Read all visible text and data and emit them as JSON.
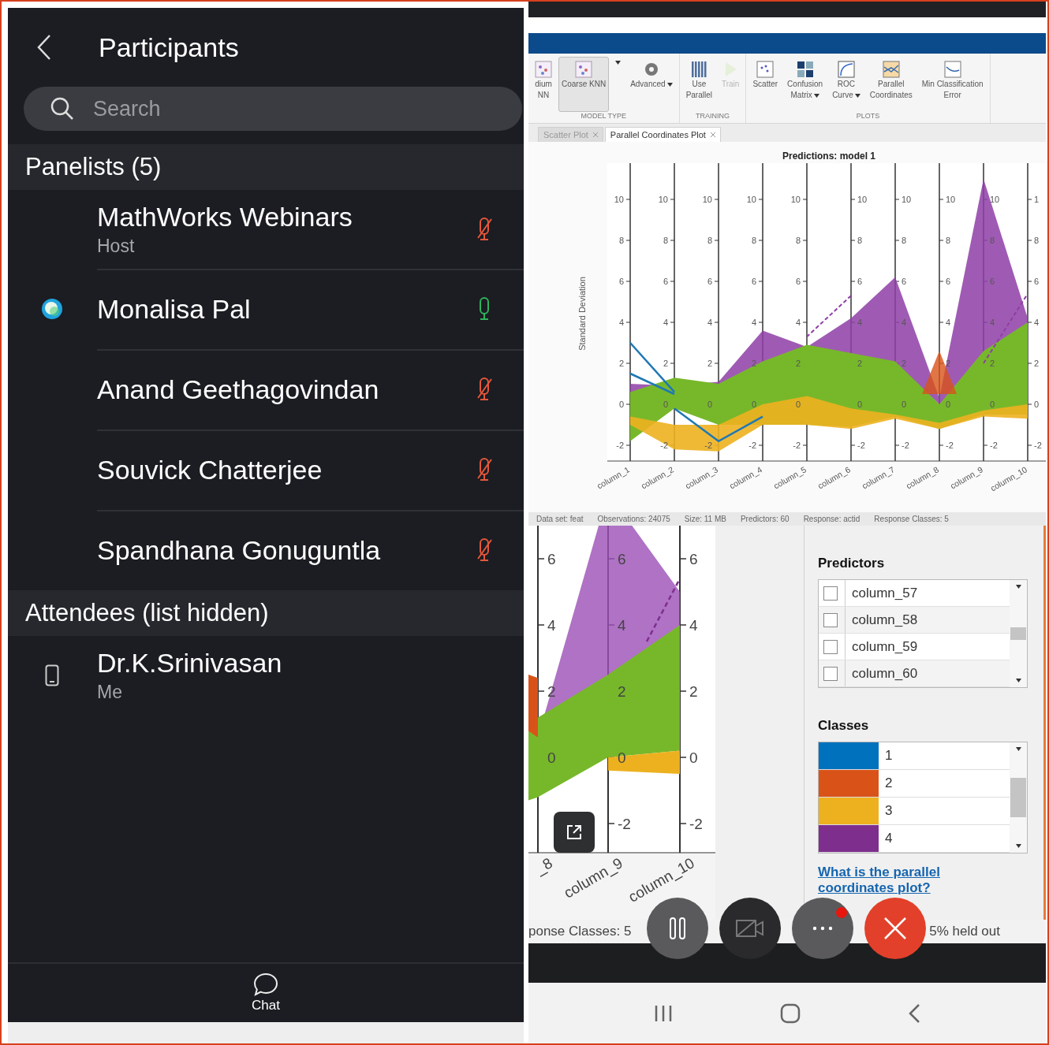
{
  "participants": {
    "title": "Participants",
    "search": {
      "placeholder": "Search"
    },
    "sections": [
      {
        "title": "Panelists (5)",
        "people": [
          {
            "name": "MathWorks Webinars",
            "role": "Host",
            "kind": "none",
            "muted": true
          },
          {
            "name": "Monalisa Pal",
            "kind": "presenter",
            "muted": false
          },
          {
            "name": "Anand Geethagovindan",
            "kind": "none",
            "muted": true
          },
          {
            "name": "Souvick Chatterjee",
            "kind": "none",
            "muted": true
          },
          {
            "name": "Spandhana Gonuguntla",
            "kind": "none",
            "muted": true
          }
        ]
      },
      {
        "title": "Attendees (list hidden)",
        "people": [
          {
            "name": "Dr.K.Srinivasan",
            "role": "Me",
            "kind": "phone"
          }
        ]
      }
    ],
    "chat": {
      "label": "Chat"
    }
  },
  "shared_screen": {
    "toolstrip": [
      {
        "label": "MODEL TYPE",
        "items": [
          {
            "kind": "knn",
            "lines": [
              "dium",
              "NN"
            ],
            "selected": false,
            "disabled": false,
            "menu": false
          },
          {
            "kind": "knn",
            "lines": [
              "Coarse KNN"
            ],
            "selected": true,
            "disabled": false,
            "menu": false
          },
          {
            "kind": "dropdown",
            "selected": false,
            "disabled": false,
            "menu": true
          },
          {
            "kind": "gear",
            "lines": [
              "Advanced"
            ],
            "selected": false,
            "disabled": false,
            "menu": true
          }
        ]
      },
      {
        "label": "TRAINING",
        "items": [
          {
            "kind": "parallel",
            "lines": [
              "Use",
              "Parallel"
            ],
            "selected": false,
            "disabled": false,
            "menu": false
          },
          {
            "kind": "train",
            "lines": [
              "Train"
            ],
            "selected": false,
            "disabled": true,
            "menu": false
          }
        ]
      },
      {
        "label": "PLOTS",
        "items": [
          {
            "kind": "scatter",
            "lines": [
              "Scatter"
            ],
            "selected": false,
            "disabled": false,
            "menu": false
          },
          {
            "kind": "matrix",
            "lines": [
              "Confusion",
              "Matrix"
            ],
            "selected": false,
            "disabled": false,
            "menu": true
          },
          {
            "kind": "roc",
            "lines": [
              "ROC",
              "Curve"
            ],
            "selected": false,
            "disabled": false,
            "menu": true
          },
          {
            "kind": "coords",
            "lines": [
              "Parallel",
              "Coordinates"
            ],
            "selected": false,
            "disabled": false,
            "menu": false
          },
          {
            "kind": "error",
            "lines": [
              "Min Classification",
              "Error"
            ],
            "selected": false,
            "disabled": false,
            "menu": false
          }
        ]
      }
    ],
    "tabs": [
      {
        "label": "Scatter Plot",
        "selected": false
      },
      {
        "label": "Parallel Coordinates Plot",
        "selected": true
      }
    ],
    "plot": {
      "title": "Predictions: model 1",
      "ylabel": "Standard Deviation",
      "axes": [
        {
          "label": "column_1",
          "ticks": [
            "10",
            "8",
            "6",
            "4",
            "2",
            "0",
            "-2"
          ]
        },
        {
          "label": "column_2",
          "ticks": [
            "10",
            "8",
            "6",
            "4",
            "2",
            "0",
            "-2"
          ]
        },
        {
          "label": "column_3",
          "ticks": [
            "10",
            "8",
            "6",
            "4",
            "2",
            "0",
            "-2"
          ]
        },
        {
          "label": "column_4",
          "ticks": [
            "10",
            "8",
            "6",
            "4",
            "2",
            "0",
            "-2"
          ]
        },
        {
          "label": "column_5",
          "ticks": [
            "10",
            "8",
            "6",
            "4",
            "2",
            "0",
            "-2"
          ]
        },
        {
          "label": "column_6",
          "ticks": [
            "10",
            "8",
            "6",
            "4",
            "2",
            "0",
            "-2"
          ]
        },
        {
          "label": "column_7",
          "ticks": [
            "10",
            "8",
            "6",
            "4",
            "2",
            "0",
            "-2"
          ]
        },
        {
          "label": "column_8",
          "ticks": [
            "10",
            "8",
            "6",
            "4",
            "2",
            "0",
            "-2"
          ]
        },
        {
          "label": "column_9",
          "ticks": [
            "10",
            "8",
            "6",
            "4",
            "2",
            "0",
            "-2"
          ]
        },
        {
          "label": "column_10",
          "ticks": [
            "1",
            "8",
            "6",
            "4",
            "2",
            "0",
            "-2"
          ]
        }
      ]
    },
    "status": [
      "Data set: feat",
      "Observations: 24075",
      "Size: 11 MB",
      "Predictors: 60",
      "Response: actid",
      "Response Classes: 5"
    ],
    "zoomed_plot": {
      "axes": [
        {
          "label": "_8",
          "ticks": [
            "6",
            "4",
            "2",
            "0"
          ]
        },
        {
          "label": "column_9",
          "ticks": [
            "6",
            "4",
            "2",
            "0",
            "-2"
          ]
        },
        {
          "label": "column_10",
          "ticks": [
            "6",
            "4",
            "2",
            "0",
            "-2"
          ]
        }
      ]
    },
    "predictors": {
      "title": "Predictors",
      "items": [
        {
          "label": "column_57",
          "checked": false
        },
        {
          "label": "column_58",
          "checked": false
        },
        {
          "label": "column_59",
          "checked": false
        },
        {
          "label": "column_60",
          "checked": false
        }
      ]
    },
    "classes": {
      "title": "Classes",
      "items": [
        {
          "label": "1",
          "color": "#0072bd"
        },
        {
          "label": "2",
          "color": "#d95319"
        },
        {
          "label": "3",
          "color": "#edb120"
        },
        {
          "label": "4",
          "color": "#7e2f8e"
        }
      ]
    },
    "help_link": "What is the parallel coordinates plot?",
    "lower_status": [
      "ponse Classes: 5",
      "5% held out"
    ]
  },
  "call_controls": {
    "more_badge": true
  }
}
